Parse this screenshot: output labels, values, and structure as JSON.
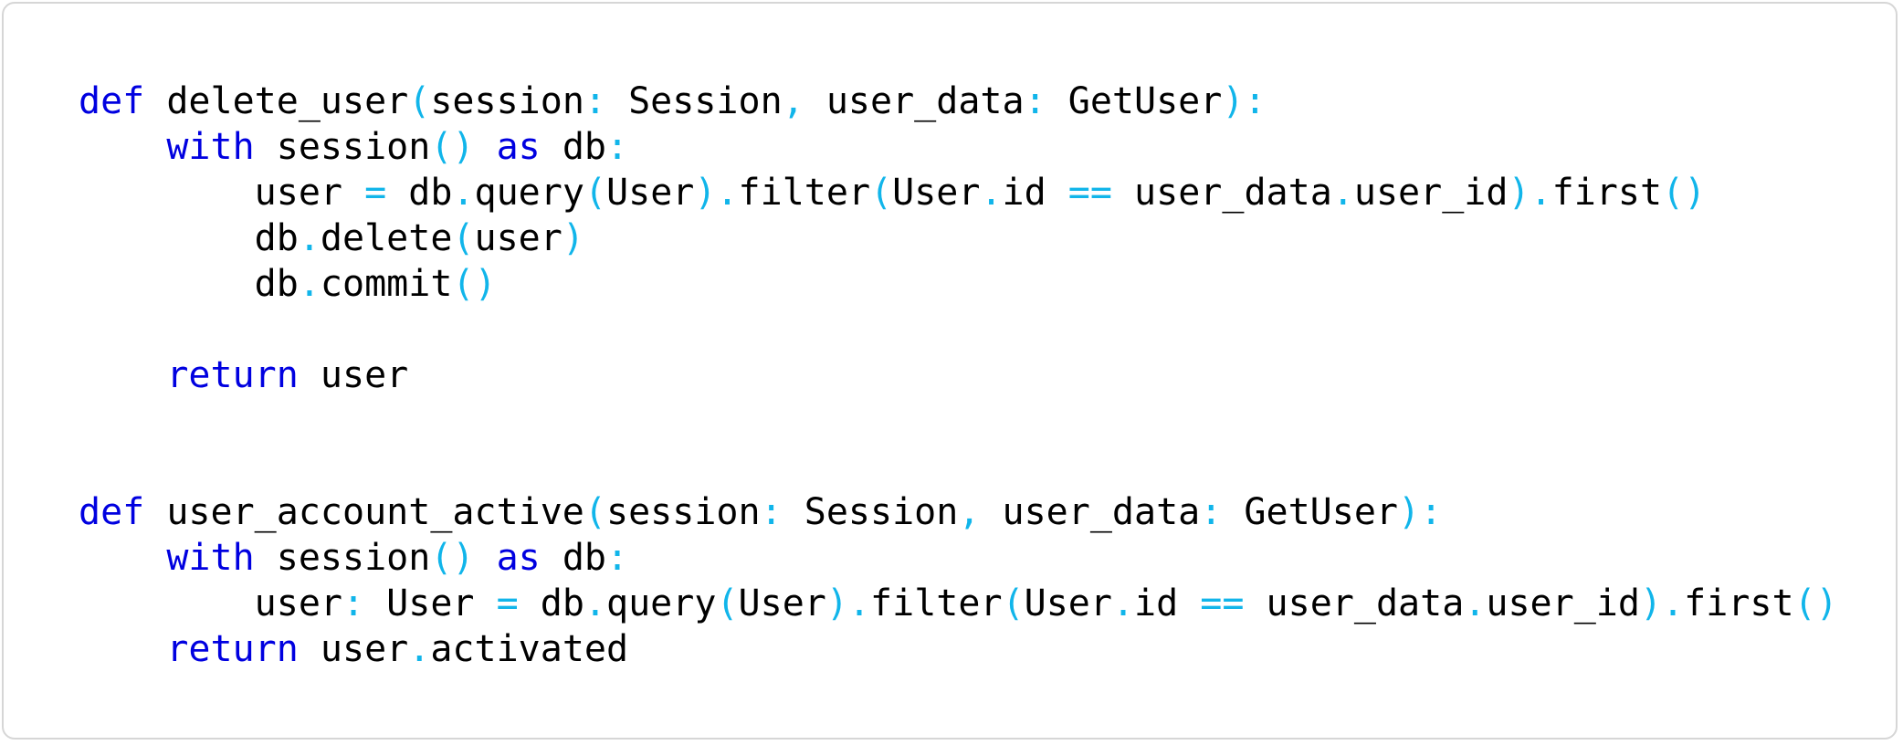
{
  "code_block": {
    "language": "python",
    "colors": {
      "keyword": "#0000e0",
      "punctuation": "#11b5ea",
      "identifier": "#000000",
      "border": "#d6d6d6",
      "background": "#ffffff"
    },
    "lines": [
      [
        [
          "kw",
          "def"
        ],
        [
          "id",
          " delete_user"
        ],
        [
          "pu",
          "("
        ],
        [
          "id",
          "session"
        ],
        [
          "pu",
          ":"
        ],
        [
          "id",
          " Session"
        ],
        [
          "pu",
          ","
        ],
        [
          "id",
          " user_data"
        ],
        [
          "pu",
          ":"
        ],
        [
          "id",
          " GetUser"
        ],
        [
          "pu",
          "):"
        ]
      ],
      [
        [
          "id",
          "    "
        ],
        [
          "kw",
          "with"
        ],
        [
          "id",
          " session"
        ],
        [
          "pu",
          "()"
        ],
        [
          "id",
          " "
        ],
        [
          "kw",
          "as"
        ],
        [
          "id",
          " db"
        ],
        [
          "pu",
          ":"
        ]
      ],
      [
        [
          "id",
          "        user "
        ],
        [
          "pu",
          "="
        ],
        [
          "id",
          " db"
        ],
        [
          "pu",
          "."
        ],
        [
          "id",
          "query"
        ],
        [
          "pu",
          "("
        ],
        [
          "id",
          "User"
        ],
        [
          "pu",
          ")."
        ],
        [
          "id",
          "filter"
        ],
        [
          "pu",
          "("
        ],
        [
          "id",
          "User"
        ],
        [
          "pu",
          "."
        ],
        [
          "id",
          "id "
        ],
        [
          "pu",
          "=="
        ],
        [
          "id",
          " user_data"
        ],
        [
          "pu",
          "."
        ],
        [
          "id",
          "user_id"
        ],
        [
          "pu",
          ")."
        ],
        [
          "id",
          "first"
        ],
        [
          "pu",
          "()"
        ]
      ],
      [
        [
          "id",
          "        db"
        ],
        [
          "pu",
          "."
        ],
        [
          "id",
          "delete"
        ],
        [
          "pu",
          "("
        ],
        [
          "id",
          "user"
        ],
        [
          "pu",
          ")"
        ]
      ],
      [
        [
          "id",
          "        db"
        ],
        [
          "pu",
          "."
        ],
        [
          "id",
          "commit"
        ],
        [
          "pu",
          "()"
        ]
      ],
      [],
      [
        [
          "id",
          "    "
        ],
        [
          "kw",
          "return"
        ],
        [
          "id",
          " user"
        ]
      ],
      [],
      [],
      [
        [
          "kw",
          "def"
        ],
        [
          "id",
          " user_account_active"
        ],
        [
          "pu",
          "("
        ],
        [
          "id",
          "session"
        ],
        [
          "pu",
          ":"
        ],
        [
          "id",
          " Session"
        ],
        [
          "pu",
          ","
        ],
        [
          "id",
          " user_data"
        ],
        [
          "pu",
          ":"
        ],
        [
          "id",
          " GetUser"
        ],
        [
          "pu",
          "):"
        ]
      ],
      [
        [
          "id",
          "    "
        ],
        [
          "kw",
          "with"
        ],
        [
          "id",
          " session"
        ],
        [
          "pu",
          "()"
        ],
        [
          "id",
          " "
        ],
        [
          "kw",
          "as"
        ],
        [
          "id",
          " db"
        ],
        [
          "pu",
          ":"
        ]
      ],
      [
        [
          "id",
          "        user"
        ],
        [
          "pu",
          ":"
        ],
        [
          "id",
          " User "
        ],
        [
          "pu",
          "="
        ],
        [
          "id",
          " db"
        ],
        [
          "pu",
          "."
        ],
        [
          "id",
          "query"
        ],
        [
          "pu",
          "("
        ],
        [
          "id",
          "User"
        ],
        [
          "pu",
          ")."
        ],
        [
          "id",
          "filter"
        ],
        [
          "pu",
          "("
        ],
        [
          "id",
          "User"
        ],
        [
          "pu",
          "."
        ],
        [
          "id",
          "id "
        ],
        [
          "pu",
          "=="
        ],
        [
          "id",
          " user_data"
        ],
        [
          "pu",
          "."
        ],
        [
          "id",
          "user_id"
        ],
        [
          "pu",
          ")."
        ],
        [
          "id",
          "first"
        ],
        [
          "pu",
          "()"
        ]
      ],
      [
        [
          "id",
          "    "
        ],
        [
          "kw",
          "return"
        ],
        [
          "id",
          " user"
        ],
        [
          "pu",
          "."
        ],
        [
          "id",
          "activated"
        ]
      ]
    ]
  }
}
